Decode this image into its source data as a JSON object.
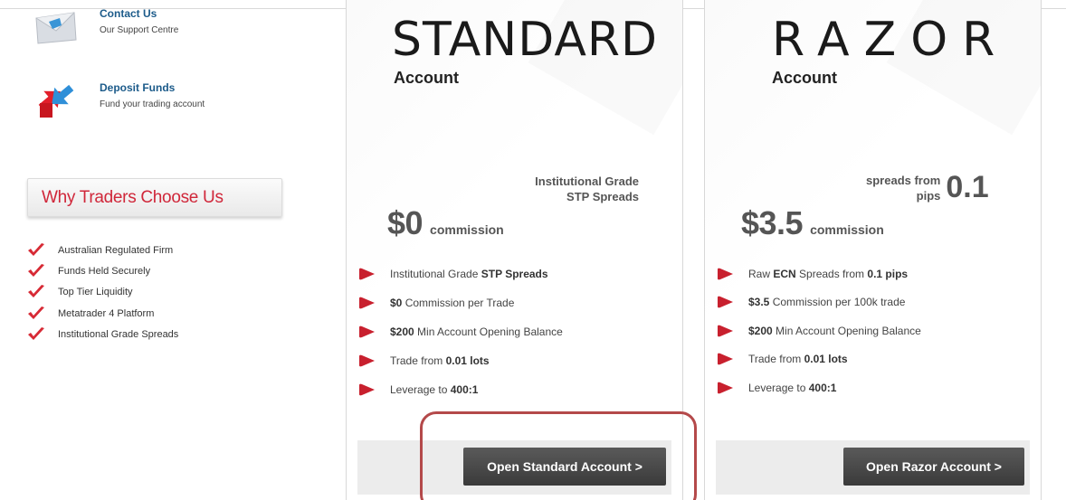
{
  "sidebar": {
    "contact": {
      "title": "Contact Us",
      "subtitle": "Our Support Centre"
    },
    "deposit": {
      "title": "Deposit Funds",
      "subtitle": "Fund your trading account"
    },
    "why_title": "Why Traders Choose Us",
    "reasons": [
      "Australian Regulated Firm",
      "Funds Held Securely",
      "Top Tier Liquidity",
      "Metatrader 4 Platform",
      "Institutional Grade Spreads"
    ]
  },
  "standard": {
    "brand": "STANDARD",
    "account_label": "Account",
    "grade_line1": "Institutional Grade",
    "grade_line2": "STP Spreads",
    "price": "$0",
    "price_word": "commission",
    "features": [
      {
        "pre": "Institutional Grade ",
        "bold": "STP Spreads",
        "post": ""
      },
      {
        "pre": "",
        "bold": "$0",
        "post": " Commission per Trade"
      },
      {
        "pre": "",
        "bold": "$200",
        "post": " Min Account Opening Balance"
      },
      {
        "pre": "Trade from ",
        "bold": "0.01 lots",
        "post": ""
      },
      {
        "pre": "Leverage to ",
        "bold": "400:1",
        "post": ""
      }
    ],
    "button": "Open Standard Account >"
  },
  "razor": {
    "brand": "RAZOR",
    "account_label": "Account",
    "spread_line1": "spreads from",
    "spread_line2": "pips",
    "spread_value": "0.1",
    "price": "$3.5",
    "price_word": "commission",
    "features": [
      {
        "pre": "Raw ",
        "bold": "ECN",
        "post": " Spreads from ",
        "bold2": "0.1 pips"
      },
      {
        "pre": "",
        "bold": "$3.5",
        "post": " Commission per 100k trade",
        "bold2": ""
      },
      {
        "pre": "",
        "bold": "$200",
        "post": " Min Account Opening Balance",
        "bold2": ""
      },
      {
        "pre": "Trade from ",
        "bold": "0.01 lots",
        "post": "",
        "bold2": ""
      },
      {
        "pre": "Leverage to ",
        "bold": "400:1",
        "post": "",
        "bold2": ""
      }
    ],
    "button": "Open Razor Account >"
  },
  "colors": {
    "link_blue": "#1c5b8a",
    "why_red": "#d0273a",
    "bullet_red": "#c8202e",
    "button_dark": "#444444",
    "highlight": "#b4494a"
  },
  "icons": {
    "contact": "envelope-icon",
    "deposit": "transfer-arrows-icon",
    "check": "check-icon",
    "bullet": "bullet-icon"
  }
}
